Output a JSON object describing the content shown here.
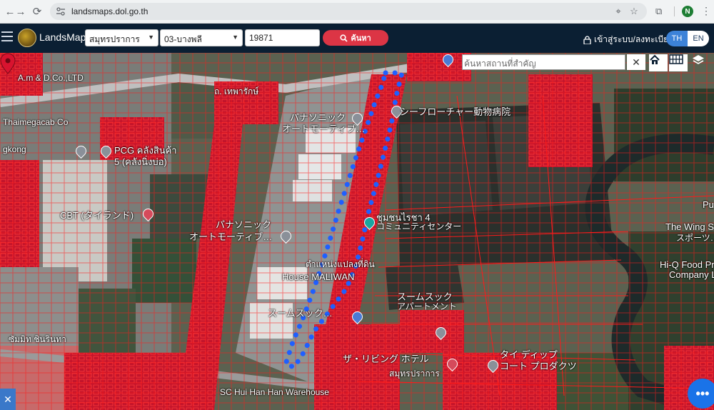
{
  "browser": {
    "url": "landsmaps.dol.go.th",
    "profile_initial": "N"
  },
  "header": {
    "brand": "LandsMaps",
    "province": "สมุทรปราการ",
    "district": "03-บางพลี",
    "parcel_number": "19871",
    "search_label": "ค้นหา",
    "login_label": "เข้าสู่ระบบ/ลงทะเบียน",
    "lang_th": "TH",
    "lang_en": "EN"
  },
  "map": {
    "search_placeholder": "ค้นหาสถานที่สำคัญ",
    "clear_symbol": "✕",
    "fab_symbol": "•••",
    "labels": [
      "A.m & D.Co.,LTD",
      "Thaimegacab Co",
      "gkong",
      "PCG คลังสินค้า",
      "5 (คลังนิ่งบ่อ)",
      "CBT (タイランド)",
      "パナソニック",
      "オートモーティブ…",
      "パナソニック",
      "オートモーティブ…",
      "ถ. เทพารักษ์",
      "シーフローチャー動物病院",
      "ชุมชนไรชา 4",
      "コミュニティセンター",
      "ตำแหน่งแปลงที่ดิน",
      "House MALIWAN",
      "スームスック",
      "アパートメント",
      "スームスック…",
      "ザ・リビング ホテル",
      "สมุทรปราการ",
      "タイ ディップ",
      "コート プロダクツ",
      "The Wing S",
      "スポーツ…",
      "Hi-Q Food Pr",
      "Company L",
      "Pu",
      "ซัมมิท ชินรินทา",
      "SC Hui Han Han Warehouse"
    ]
  },
  "colors": {
    "header_bg": "#0b1f33",
    "parcel_line": "#ff1a1a",
    "route_dot": "#1f5fff",
    "search_button": "#dc3545",
    "lang_active": "#3c82d8",
    "fab": "#1a73e8"
  }
}
